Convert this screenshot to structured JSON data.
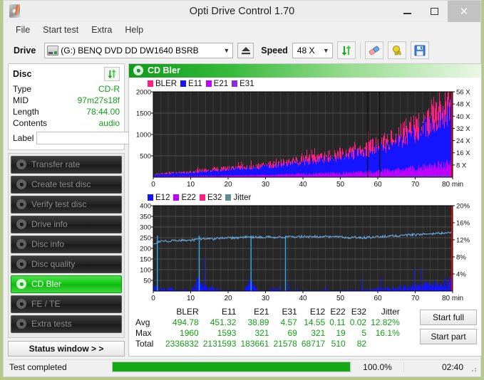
{
  "window": {
    "title": "Opti Drive Control 1.70",
    "app_icon": "disc-pen-icon",
    "minimize": "minimize-icon",
    "maximize": "maximize-icon",
    "close": "✕"
  },
  "menu": {
    "items": [
      "File",
      "Start test",
      "Extra",
      "Help"
    ]
  },
  "toolbar": {
    "drive_label": "Drive",
    "drive_value": "(G:)   BENQ DVD DD DW1640 BSRB",
    "eject_icon": "eject-icon",
    "speed_label": "Speed",
    "speed_value": "48 X",
    "refresh_icon": "refresh-arrows-icon",
    "erase_icon": "eraser-icon",
    "bulb_icon": "bulb-icon",
    "save_icon": "floppy-save-icon"
  },
  "disc": {
    "header": "Disc",
    "refresh_icon": "refresh-arrows-icon",
    "rows": [
      {
        "key": "Type",
        "value": "CD-R"
      },
      {
        "key": "MID",
        "value": "97m27s18f"
      },
      {
        "key": "Length",
        "value": "78:44.00"
      },
      {
        "key": "Contents",
        "value": "audio"
      }
    ],
    "label_key": "Label",
    "label_value": "",
    "label_placeholder": "",
    "cd_icon": "cd-disc-icon"
  },
  "nav": {
    "items": [
      {
        "label": "Transfer rate",
        "icon": "disc-icon",
        "active": false
      },
      {
        "label": "Create test disc",
        "icon": "disc-icon",
        "active": false
      },
      {
        "label": "Verify test disc",
        "icon": "disc-icon",
        "active": false
      },
      {
        "label": "Drive info",
        "icon": "disc-icon",
        "active": false
      },
      {
        "label": "Disc info",
        "icon": "disc-icon",
        "active": false
      },
      {
        "label": "Disc quality",
        "icon": "disc-icon",
        "active": false
      },
      {
        "label": "CD Bler",
        "icon": "disc-icon",
        "active": true
      },
      {
        "label": "FE / TE",
        "icon": "disc-icon",
        "active": false
      },
      {
        "label": "Extra tests",
        "icon": "disc-icon",
        "active": false
      }
    ],
    "status_window": "Status window > >"
  },
  "panel": {
    "title": "CD Bler",
    "icon": "disc-icon"
  },
  "actions": {
    "start_full": "Start full",
    "start_part": "Start part"
  },
  "statusbar": {
    "text": "Test completed",
    "progress_pct": 100.0,
    "progress_label": "100.0%",
    "elapsed": "02:40",
    "grip": "resize-grip"
  },
  "colors": {
    "bler": "#ff1f80",
    "e11": "#1414ff",
    "e21": "#c000ff",
    "e31": "#8a2be2",
    "e12": "#1414ff",
    "e22": "#c000ff",
    "e32": "#ff1f80",
    "jitter": "#6aa9e0",
    "speed_line": "#ff0000",
    "plot_bg": "#2b2b2b",
    "grid": "#555555",
    "accent_green": "#13a013"
  },
  "chart_data": [
    {
      "type": "area",
      "name": "bler-chart",
      "title": "CD Bler",
      "xlabel": "min",
      "ylabel": "",
      "xlim": [
        0,
        80
      ],
      "ylim": [
        0,
        2000
      ],
      "xticks": [
        0,
        10,
        20,
        30,
        40,
        50,
        60,
        70,
        80
      ],
      "xtick_labels": [
        "0",
        "10",
        "20",
        "30",
        "40",
        "50",
        "60",
        "70",
        "80 min"
      ],
      "yticks": [
        500,
        1000,
        1500,
        2000
      ],
      "ytick_labels": [
        "500",
        "1000",
        "1500",
        "2000"
      ],
      "y2label": "X",
      "y2lim": [
        0,
        56
      ],
      "y2ticks": [
        8,
        16,
        24,
        32,
        40,
        48,
        56
      ],
      "y2tick_labels": [
        "8 X",
        "16 X",
        "24 X",
        "32 X",
        "40 X",
        "48 X",
        "56 X"
      ],
      "grid": true,
      "legend": [
        {
          "label": "BLER",
          "color": "#ff1f80"
        },
        {
          "label": "E11",
          "color": "#1414ff"
        },
        {
          "label": "E21",
          "color": "#c000ff"
        },
        {
          "label": "E31",
          "color": "#8a2be2"
        }
      ],
      "x": [
        0,
        2,
        4,
        6,
        8,
        10,
        12,
        14,
        16,
        18,
        20,
        22,
        24,
        26,
        28,
        30,
        32,
        34,
        36,
        38,
        40,
        42,
        44,
        46,
        48,
        50,
        52,
        54,
        56,
        58,
        60,
        62,
        64,
        66,
        68,
        70,
        72,
        74,
        76,
        78,
        80
      ],
      "series": [
        {
          "name": "BLER",
          "color": "#ff1f80",
          "values": [
            60,
            85,
            100,
            110,
            120,
            130,
            150,
            165,
            180,
            195,
            205,
            220,
            240,
            255,
            270,
            290,
            310,
            330,
            360,
            380,
            400,
            430,
            450,
            480,
            510,
            545,
            585,
            620,
            660,
            700,
            760,
            830,
            900,
            980,
            1080,
            1180,
            1290,
            1420,
            1560,
            1720,
            1900
          ]
        },
        {
          "name": "E11",
          "color": "#1414ff",
          "values": [
            50,
            72,
            86,
            96,
            104,
            112,
            130,
            142,
            156,
            168,
            178,
            190,
            208,
            222,
            234,
            250,
            268,
            286,
            312,
            330,
            346,
            372,
            390,
            416,
            442,
            472,
            506,
            536,
            570,
            604,
            656,
            716,
            776,
            844,
            930,
            1016,
            1110,
            1220,
            1340,
            1480,
            1630
          ]
        },
        {
          "name": "E21",
          "color": "#c000ff",
          "values": [
            14,
            18,
            20,
            22,
            24,
            26,
            28,
            30,
            32,
            34,
            36,
            38,
            42,
            44,
            46,
            50,
            54,
            58,
            62,
            66,
            70,
            76,
            80,
            86,
            92,
            98,
            106,
            112,
            120,
            128,
            138,
            150,
            162,
            176,
            194,
            212,
            232,
            254,
            280,
            308,
            340
          ]
        },
        {
          "name": "E31",
          "color": "#8a2be2",
          "values": [
            2,
            3,
            3,
            4,
            4,
            4,
            5,
            5,
            5,
            6,
            6,
            6,
            7,
            7,
            7,
            8,
            8,
            9,
            9,
            10,
            10,
            11,
            11,
            12,
            13,
            14,
            15,
            16,
            17,
            18,
            20,
            22,
            24,
            26,
            28,
            31,
            34,
            38,
            42,
            48,
            55
          ]
        }
      ],
      "speed_curve": {
        "name": "Speed",
        "color": "#ff0000",
        "values": [
          8,
          10,
          12,
          14,
          16,
          18,
          20,
          22,
          24,
          26,
          28,
          30,
          32,
          33,
          35,
          36,
          38,
          39,
          40,
          41,
          42,
          43,
          44,
          45,
          46,
          47,
          48,
          49,
          50,
          50,
          51,
          52,
          52,
          53,
          53,
          54,
          54,
          55,
          55,
          56,
          56
        ]
      }
    },
    {
      "type": "line",
      "name": "jitter-chart",
      "xlabel": "min",
      "xlim": [
        0,
        80
      ],
      "ylim": [
        0,
        400
      ],
      "xticks": [
        0,
        10,
        20,
        30,
        40,
        50,
        60,
        70,
        80
      ],
      "xtick_labels": [
        "0",
        "10",
        "20",
        "30",
        "40",
        "50",
        "60",
        "70",
        "80 min"
      ],
      "yticks": [
        50,
        100,
        150,
        200,
        250,
        300,
        350,
        400
      ],
      "ytick_labels": [
        "50",
        "100",
        "150",
        "200",
        "250",
        "300",
        "350",
        "400"
      ],
      "y2lim": [
        0,
        20
      ],
      "y2ticks": [
        4,
        8,
        12,
        16,
        20
      ],
      "y2tick_labels": [
        "4%",
        "8%",
        "12%",
        "16%",
        "20%"
      ],
      "grid": true,
      "legend": [
        {
          "label": "E12",
          "color": "#1414ff"
        },
        {
          "label": "E22",
          "color": "#c000ff"
        },
        {
          "label": "E32",
          "color": "#ff1f80"
        },
        {
          "label": "Jitter",
          "color": "#5f8f8f"
        }
      ],
      "x": [
        0,
        2,
        4,
        6,
        8,
        10,
        12,
        14,
        16,
        18,
        20,
        22,
        24,
        26,
        28,
        30,
        32,
        34,
        36,
        38,
        40,
        42,
        44,
        46,
        48,
        50,
        52,
        54,
        56,
        58,
        60,
        62,
        64,
        66,
        68,
        70,
        72,
        74,
        76,
        78,
        80
      ],
      "series": [
        {
          "name": "Jitter",
          "color": "#6aa9e0",
          "axis": "right",
          "values": [
            11.1,
            11.6,
            11.7,
            11.8,
            11.9,
            11.9,
            12.1,
            12.3,
            12.2,
            12.4,
            12.5,
            12.4,
            12.6,
            12.7,
            12.6,
            12.7,
            12.6,
            12.6,
            12.7,
            12.6,
            12.8,
            12.7,
            12.8,
            12.7,
            12.8,
            12.6,
            12.5,
            12.6,
            12.5,
            12.6,
            12.7,
            12.8,
            12.9,
            13.0,
            13.1,
            13.2,
            13.3,
            13.4,
            13.5,
            13.6,
            13.8
          ]
        },
        {
          "name": "E12",
          "color": "#1414ff",
          "axis": "left",
          "values": [
            130,
            40,
            70,
            22,
            30,
            14,
            250,
            100,
            80,
            28,
            18,
            16,
            14,
            250,
            12,
            14,
            60,
            16,
            30,
            14,
            12,
            14,
            18,
            20,
            16,
            20,
            24,
            28,
            34,
            40,
            52,
            62,
            78,
            96,
            110,
            128,
            150,
            175,
            205,
            240,
            290
          ]
        }
      ]
    }
  ],
  "stats": {
    "columns": [
      "BLER",
      "E11",
      "E21",
      "E31",
      "E12",
      "E22",
      "E32",
      "Jitter"
    ],
    "rows": [
      {
        "label": "Avg",
        "values": [
          "494.78",
          "451.32",
          "38.89",
          "4.57",
          "14.55",
          "0.11",
          "0.02",
          "12.82%"
        ]
      },
      {
        "label": "Max",
        "values": [
          "1960",
          "1593",
          "321",
          "69",
          "321",
          "19",
          "5",
          "16.1%"
        ]
      },
      {
        "label": "Total",
        "values": [
          "2336832",
          "2131593",
          "183661",
          "21578",
          "68717",
          "510",
          "82",
          ""
        ]
      }
    ]
  }
}
